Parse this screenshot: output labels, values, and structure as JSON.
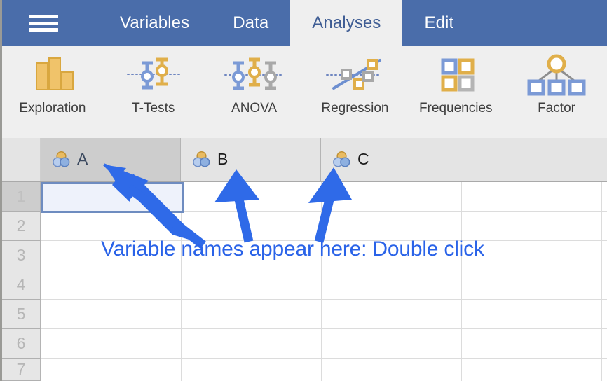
{
  "window": {
    "app": "jamovi",
    "accent_blue": "#4a6daa",
    "ribbon_bg": "#efefef",
    "annotation_color": "#2a63e8"
  },
  "menubar": {
    "menu_icon": "hamburger-menu-icon",
    "tabs": [
      {
        "label": "Variables",
        "active": false
      },
      {
        "label": "Data",
        "active": false
      },
      {
        "label": "Analyses",
        "active": true
      },
      {
        "label": "Edit",
        "active": false
      }
    ]
  },
  "ribbon": {
    "items": [
      {
        "label": "Exploration",
        "icon": "bar-chart-icon"
      },
      {
        "label": "T-Tests",
        "icon": "two-error-bars-icon"
      },
      {
        "label": "ANOVA",
        "icon": "three-error-bars-icon"
      },
      {
        "label": "Regression",
        "icon": "scatter-regression-line-icon"
      },
      {
        "label": "Frequencies",
        "icon": "four-squares-grid-icon"
      },
      {
        "label": "Factor",
        "icon": "factor-tree-icon"
      }
    ]
  },
  "spreadsheet": {
    "columns": [
      {
        "label": "A",
        "type_icon": "nominal-three-circles-icon",
        "selected": true
      },
      {
        "label": "B",
        "type_icon": "nominal-three-circles-icon",
        "selected": false
      },
      {
        "label": "C",
        "type_icon": "nominal-three-circles-icon",
        "selected": false
      },
      {
        "label": "",
        "type_icon": "",
        "selected": false
      }
    ],
    "rows": [
      {
        "number": "1",
        "selected": true
      },
      {
        "number": "2",
        "selected": false
      },
      {
        "number": "3",
        "selected": false
      },
      {
        "number": "4",
        "selected": false
      },
      {
        "number": "5",
        "selected": false
      },
      {
        "number": "6",
        "selected": false
      },
      {
        "number": "7",
        "selected": false
      }
    ],
    "selected_cell": {
      "column": "A",
      "row": "1",
      "value": ""
    }
  },
  "annotations": {
    "callout_text": "Variable names appear here: Double click",
    "arrows": [
      {
        "name": "arrow-to-column-a",
        "target": "A"
      },
      {
        "name": "arrow-to-column-b",
        "target": "B"
      },
      {
        "name": "arrow-to-column-c",
        "target": "C"
      }
    ]
  }
}
